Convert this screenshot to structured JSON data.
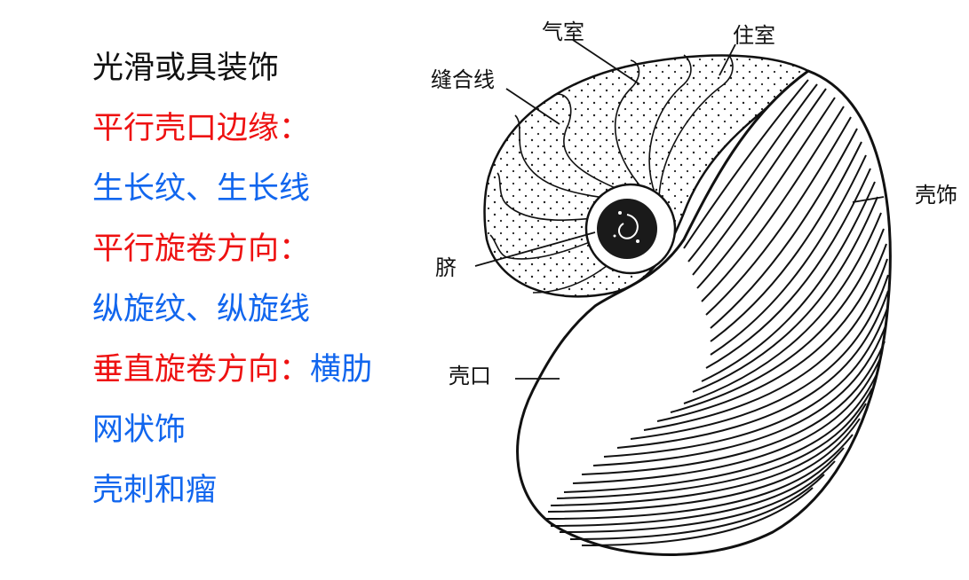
{
  "features": {
    "smooth": "光滑或具装饰",
    "parallel_aperture": "平行壳口边缘：",
    "growth_lines": "生长纹、生长线",
    "parallel_spiral": "平行旋卷方向：",
    "spiral_lines": "纵旋纹、纵旋线",
    "perp_spiral": "垂直旋卷方向：",
    "ribs": "横肋",
    "reticulate": "网状饰",
    "spines": "壳刺和瘤"
  },
  "diagram": {
    "labels": {
      "air_chamber": "气室",
      "living_chamber": "住室",
      "suture": "缝合线",
      "ornament": "壳饰",
      "umbilicus": "脐",
      "aperture": "壳口"
    }
  },
  "colors": {
    "emphasis_red": "#ee1111",
    "highlight_blue": "#1166ee",
    "text_black": "#111111"
  }
}
